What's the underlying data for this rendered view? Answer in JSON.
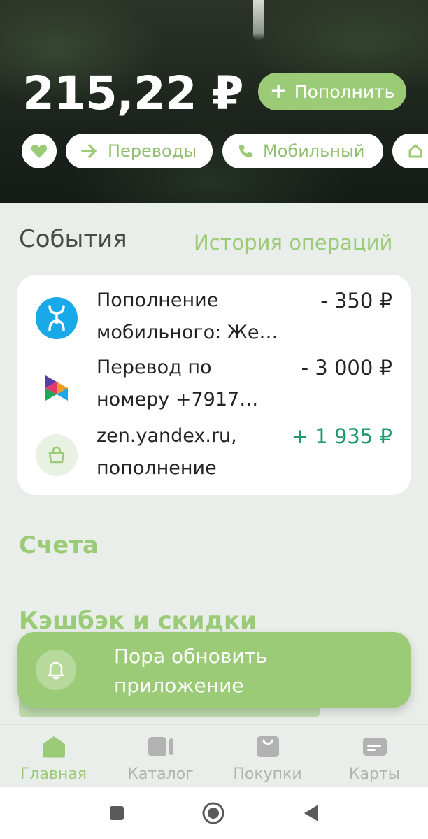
{
  "header": {
    "balance": "215,22 ₽",
    "topup_label": "Пополнить",
    "topup_plus": "+"
  },
  "quick_actions": [
    {
      "label": "",
      "icon": "heart-icon"
    },
    {
      "label": "Переводы",
      "icon": "arrow-right-icon"
    },
    {
      "label": "Мобильный",
      "icon": "phone-icon"
    },
    {
      "label": "",
      "icon": "home-icon"
    }
  ],
  "events": {
    "title": "События",
    "history_link": "История операций",
    "items": [
      {
        "line1": "Пополнение",
        "line2": "мобильного: Же…",
        "amount": "- 350 ₽",
        "icon": "yota-icon",
        "positive": false
      },
      {
        "line1": "Перевод по",
        "line2": "номеру +7917…",
        "amount": "- 3 000 ₽",
        "icon": "sbp-icon",
        "positive": false
      },
      {
        "line1": "zen.yandex.ru,",
        "line2": "пополнение",
        "amount": "+ 1 935 ₽",
        "icon": "shopping-bag-icon",
        "positive": true
      }
    ]
  },
  "sections": {
    "accounts": "Счета",
    "cashback": "Кэшбэк и скидки"
  },
  "toast": {
    "line1": "Пора обновить",
    "line2": "приложение",
    "icon": "bell-icon"
  },
  "tabbar": [
    {
      "label": "Главная",
      "icon": "home-tab-icon",
      "active": true
    },
    {
      "label": "Каталог",
      "icon": "catalog-icon",
      "active": false
    },
    {
      "label": "Покупки",
      "icon": "bag-icon",
      "active": false
    },
    {
      "label": "Карты",
      "icon": "card-icon",
      "active": false
    }
  ],
  "colors": {
    "accent": "#9ccb78",
    "positive": "#1f9a6d",
    "background": "#e9eeea",
    "yota_blue": "#1aa9e8"
  }
}
